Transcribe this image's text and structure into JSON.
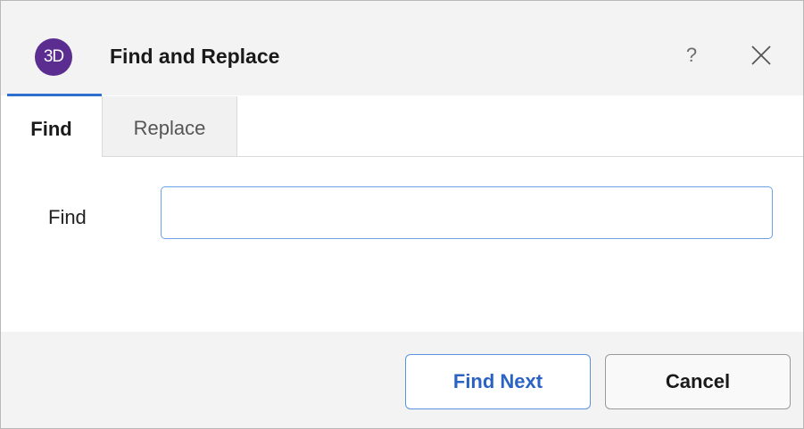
{
  "window": {
    "title": "Find and Replace",
    "app_icon_text": "3D",
    "help_label": "?",
    "accent_color": "#2f6fce",
    "logo_color": "#5b2d90"
  },
  "tabs": [
    {
      "label": "Find",
      "selected": true
    },
    {
      "label": "Replace",
      "selected": false
    }
  ],
  "find": {
    "label": "Find",
    "value": "",
    "placeholder": ""
  },
  "buttons": {
    "find_next": "Find Next",
    "cancel": "Cancel"
  }
}
